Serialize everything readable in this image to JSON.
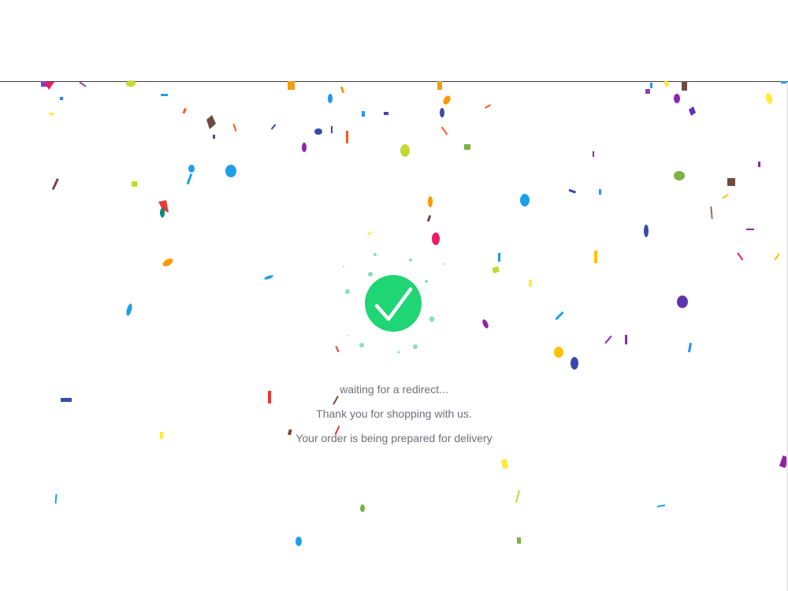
{
  "messages": {
    "redirect": "waiting for a redirect...",
    "thanks": "Thank you for shopping with us.",
    "delivery": "Your order is being prepared for delivery"
  },
  "colors": {
    "accent_green": "#1fd574",
    "text_gray": "#6f6f78",
    "dot_green": "#8ae0bb"
  },
  "icons": {
    "success": "check-circle-icon"
  }
}
